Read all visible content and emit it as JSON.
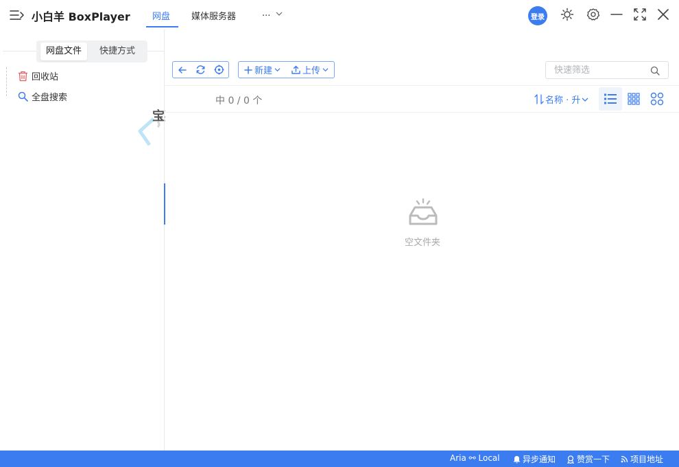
{
  "header": {
    "app_title": "小白羊 BoxPlayer",
    "tabs": [
      {
        "label": "网盘",
        "active": true
      },
      {
        "label": "媒体服务器",
        "active": false
      }
    ],
    "more_label": "...",
    "login_label": "登录"
  },
  "left_panel": {
    "tabs": [
      {
        "label": "网盘文件",
        "active": true
      },
      {
        "label": "快捷方式",
        "active": false
      }
    ],
    "items": [
      {
        "label": "回收站",
        "icon": "trash-icon"
      },
      {
        "label": "全盘搜索",
        "icon": "search-icon"
      }
    ],
    "watermark_text": "宝藏星球屋"
  },
  "toolbar": {
    "new_label": "新建",
    "upload_label": "上传",
    "search_placeholder": "快速筛选"
  },
  "list": {
    "count_text": "中 0 / 0 个",
    "sort_label": "名称 · 升",
    "empty_text": "空文件夹"
  },
  "statusbar": {
    "aria_label": "Aria ⚯ Local",
    "notify_label": "异步通知",
    "reward_label": "赞赏一下",
    "project_label": "项目地址"
  },
  "colors": {
    "accent": "#3b7cf0",
    "trash": "#e85c5c",
    "status_bar": "#3b7cf0"
  }
}
